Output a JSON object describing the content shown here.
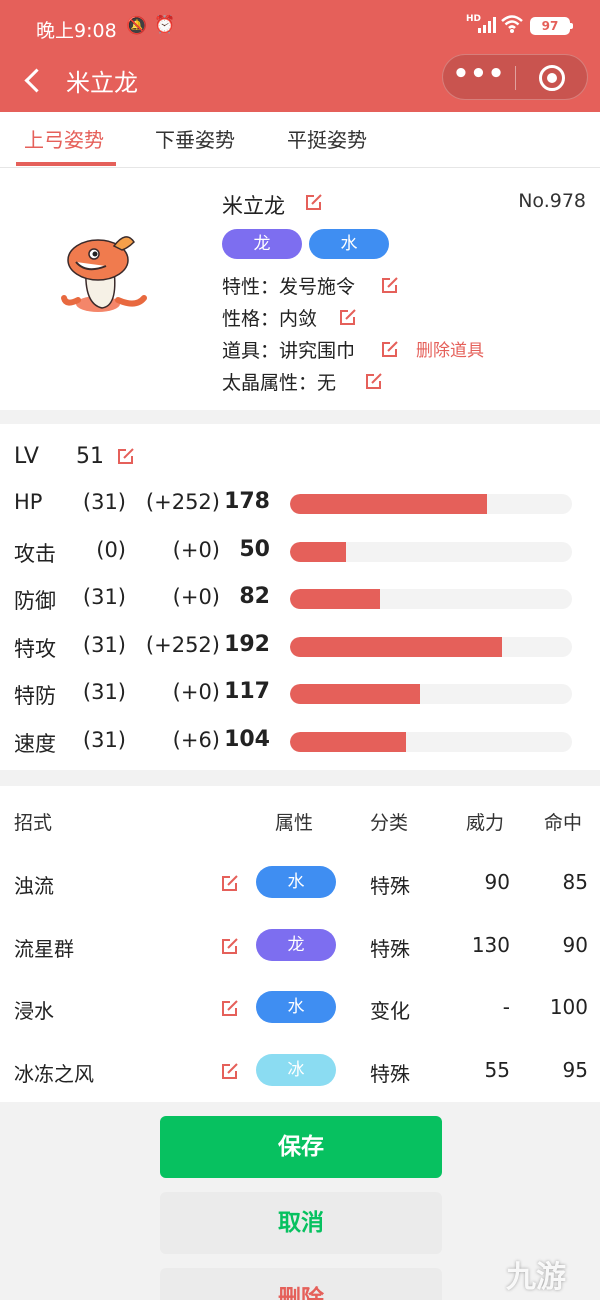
{
  "status_bar": {
    "time": "晚上9:08",
    "network": "HD",
    "battery": "97"
  },
  "header": {
    "title": "米立龙"
  },
  "tabs": [
    {
      "label": "上弓姿势",
      "active": true
    },
    {
      "label": "下垂姿势",
      "active": false
    },
    {
      "label": "平挺姿势",
      "active": false
    }
  ],
  "pokemon": {
    "name": "米立龙",
    "number": "No.978",
    "types": [
      {
        "label": "龙",
        "color": "#7d6ef0"
      },
      {
        "label": "水",
        "color": "#3f8ef2"
      }
    ],
    "ability": "特性：发号施令",
    "nature": "性格：内敛",
    "item": "道具：讲究围巾",
    "delete_item_label": "删除道具",
    "tera_type": "太晶属性：无"
  },
  "stats": {
    "lv_label": "LV",
    "lv_value": "51",
    "rows": [
      {
        "name": "HP",
        "iv": "(31)",
        "ev": "(+252)",
        "value": "178",
        "fill": 0.7
      },
      {
        "name": "攻击",
        "iv": "(0)",
        "ev": "(+0)",
        "value": "50",
        "fill": 0.2
      },
      {
        "name": "防御",
        "iv": "(31)",
        "ev": "(+0)",
        "value": "82",
        "fill": 0.32
      },
      {
        "name": "特攻",
        "iv": "(31)",
        "ev": "(+252)",
        "value": "192",
        "fill": 0.75
      },
      {
        "name": "特防",
        "iv": "(31)",
        "ev": "(+0)",
        "value": "117",
        "fill": 0.46
      },
      {
        "name": "速度",
        "iv": "(31)",
        "ev": "(+6)",
        "value": "104",
        "fill": 0.41
      }
    ]
  },
  "moves": {
    "headers": {
      "move": "招式",
      "type": "属性",
      "category": "分类",
      "power": "威力",
      "accuracy": "命中"
    },
    "rows": [
      {
        "name": "浊流",
        "type": "水",
        "type_color": "#3f8ef2",
        "category": "特殊",
        "power": "90",
        "accuracy": "85"
      },
      {
        "name": "流星群",
        "type": "龙",
        "type_color": "#7d6ef0",
        "category": "特殊",
        "power": "130",
        "accuracy": "90"
      },
      {
        "name": "浸水",
        "type": "水",
        "type_color": "#3f8ef2",
        "category": "变化",
        "power": "-",
        "accuracy": "100"
      },
      {
        "name": "冰冻之风",
        "type": "冰",
        "type_color": "#8bdcf2",
        "category": "特殊",
        "power": "55",
        "accuracy": "95"
      }
    ]
  },
  "buttons": {
    "save": "保存",
    "cancel": "取消",
    "delete": "删除"
  },
  "watermark": {
    "text": "九游"
  },
  "colors": {
    "accent": "#e5605a",
    "save_green": "#07c160"
  }
}
